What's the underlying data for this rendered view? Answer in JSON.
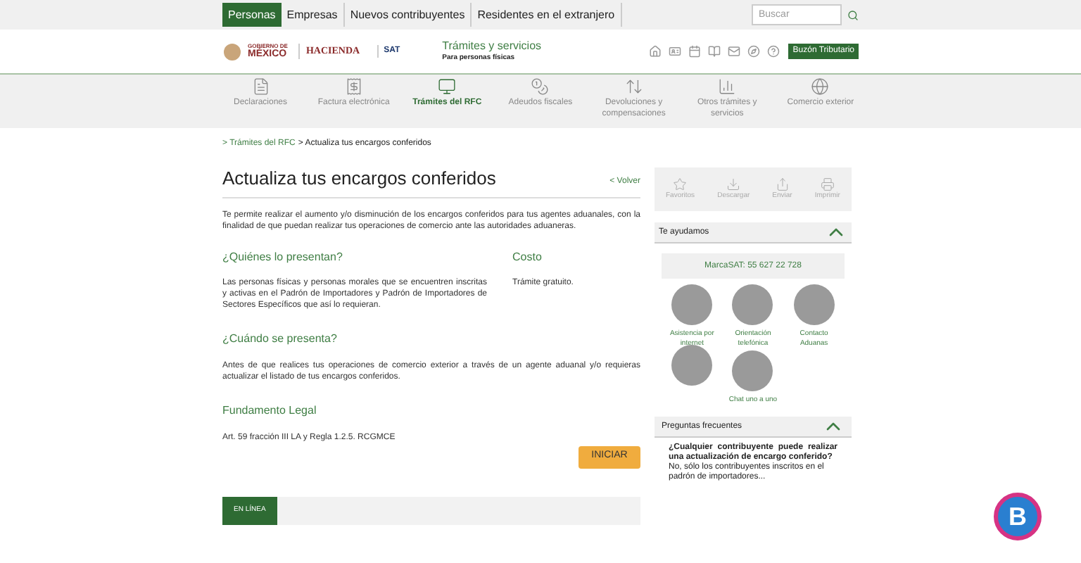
{
  "top_nav": {
    "tabs": [
      {
        "label": "Personas",
        "selected": true
      },
      {
        "label": "Empresas",
        "selected": false
      },
      {
        "label": "Nuevos contribuyentes",
        "selected": false
      },
      {
        "label": "Residentes en el extranjero",
        "selected": false
      }
    ],
    "search": {
      "placeholder": "Buscar"
    }
  },
  "header": {
    "gov_logo": {
      "line1": "GOBIERNO DE",
      "line2": "MÉXICO"
    },
    "hacienda": "HACIENDA",
    "sat": "SAT",
    "title": "Trámites y servicios",
    "subtitle": "Para personas físicas",
    "buzon_button": "Buzón Tributario"
  },
  "categories": [
    {
      "label": "Declaraciones",
      "selected": false,
      "kind": "doc"
    },
    {
      "label": "Factura electrónica",
      "selected": false,
      "kind": "invoice"
    },
    {
      "label": "Trámites del RFC",
      "selected": true,
      "kind": "rfc"
    },
    {
      "label": "Adeudos fiscales",
      "selected": false,
      "kind": "debt"
    },
    {
      "label": "Devoluciones y compensaciones",
      "selected": false,
      "kind": "refund"
    },
    {
      "label": "Otros trámites y servicios",
      "selected": false,
      "kind": "other"
    },
    {
      "label": "Comercio exterior",
      "selected": false,
      "kind": "trade"
    }
  ],
  "breadcrumb": {
    "link": "> Trámites del RFC",
    "current": "> Actualiza tus encargos conferidos"
  },
  "main": {
    "title": "Actualiza tus encargos conferidos",
    "back_link": "< Volver",
    "intro": "Te permite realizar el aumento y/o disminución de los encargos conferidos para tus agentes aduanales, con la finalidad de que puedan realizar tus operaciones de comercio ante las autoridades aduaneras.",
    "who": {
      "heading": "¿Quiénes lo presentan?",
      "text": "Las personas físicas y personas morales que se encuentren inscritas y activas en el Padrón de Importadores y Padrón de Importadores de Sectores Específicos que así lo requieran."
    },
    "cost": {
      "heading": "Costo",
      "text": "Trámite gratuito."
    },
    "when": {
      "heading": "¿Cuándo se presenta?",
      "text": "Antes de que realices tus operaciones de comercio exterior a través de un agente aduanal y/o requieras actualizar el listado de tus encargos conferidos."
    },
    "legal": {
      "heading": "Fundamento Legal",
      "text": "Art. 59 fracción III LA y Regla 1.2.5. RCGMCE"
    },
    "start_button": "INICIAR",
    "online_tab": "EN LÍNEA"
  },
  "sidebar": {
    "actions": [
      {
        "label": "Favoritos",
        "kind": "star"
      },
      {
        "label": "Descargar",
        "kind": "download"
      },
      {
        "label": "Enviar",
        "kind": "send"
      },
      {
        "label": "Imprimir",
        "kind": "print"
      }
    ],
    "help": {
      "heading": "Te ayudamos",
      "expanded": true,
      "phone": "MarcaSAT: 55 627 22 728",
      "contacts": [
        {
          "kind": "labeled",
          "label": "Asistencia por internet"
        },
        {
          "kind": "labeled",
          "label": "Orientación telefónica"
        },
        {
          "kind": "labeled",
          "label": "Contacto Aduanas"
        },
        {
          "kind": "photo_only"
        },
        {
          "kind": "labeled",
          "label": "Chat uno a uno"
        }
      ]
    },
    "faq": {
      "heading": "Preguntas frecuentes",
      "expanded": true,
      "question": "¿Cualquier contribuyente puede realizar una actualización de encargo conferido?",
      "answer": "No, sólo los contribuyentes inscritos en el padrón de importadores..."
    }
  },
  "floating_badge": {
    "letter": "B"
  }
}
